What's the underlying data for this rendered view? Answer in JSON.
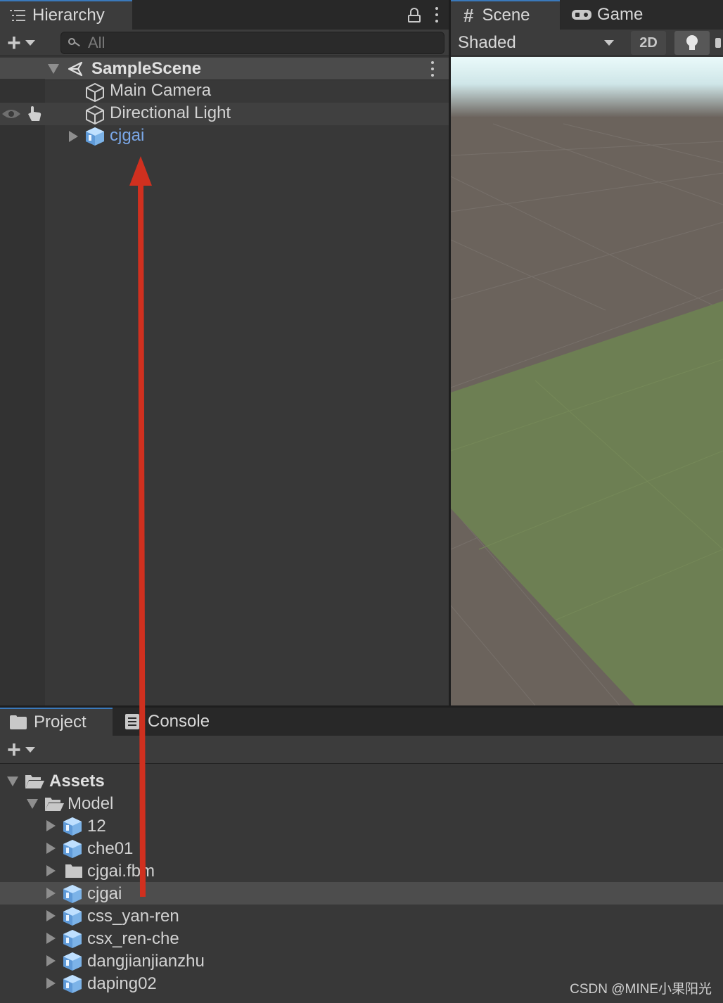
{
  "hierarchy": {
    "tab_label": "Hierarchy",
    "search_placeholder": "All",
    "scene_name": "SampleScene",
    "items": [
      {
        "label": "Main Camera",
        "type": "gameobject",
        "color": "#d2d2d2"
      },
      {
        "label": "Directional Light",
        "type": "gameobject",
        "color": "#d2d2d2"
      },
      {
        "label": "cjgai",
        "type": "prefab",
        "color": "#7ba8e8"
      }
    ]
  },
  "scene_view": {
    "tabs": [
      {
        "label": "Scene",
        "icon": "grid-hash-icon",
        "active": true
      },
      {
        "label": "Game",
        "icon": "gamepad-icon",
        "active": false
      }
    ],
    "shading_mode": "Shaded",
    "mode_2d_label": "2D",
    "colors": {
      "sky": "#dff3f5",
      "ground": "#6b635c",
      "plane": "#6d7f53"
    }
  },
  "project": {
    "tabs": [
      {
        "label": "Project",
        "icon": "folder-icon",
        "active": true
      },
      {
        "label": "Console",
        "icon": "console-icon",
        "active": false
      }
    ],
    "tree": {
      "root": "Assets",
      "folder": "Model",
      "items": [
        {
          "label": "12",
          "type": "model"
        },
        {
          "label": "che01",
          "type": "model"
        },
        {
          "label": "cjgai.fbm",
          "type": "folder"
        },
        {
          "label": "cjgai",
          "type": "model",
          "selected": true
        },
        {
          "label": "css_yan-ren",
          "type": "model"
        },
        {
          "label": "csx_ren-che",
          "type": "model"
        },
        {
          "label": "dangjianjianzhu",
          "type": "model"
        },
        {
          "label": "daping02",
          "type": "model"
        }
      ]
    }
  },
  "annotation": {
    "arrow_color": "#d0301f"
  },
  "watermark": "CSDN @MINE小果阳光"
}
